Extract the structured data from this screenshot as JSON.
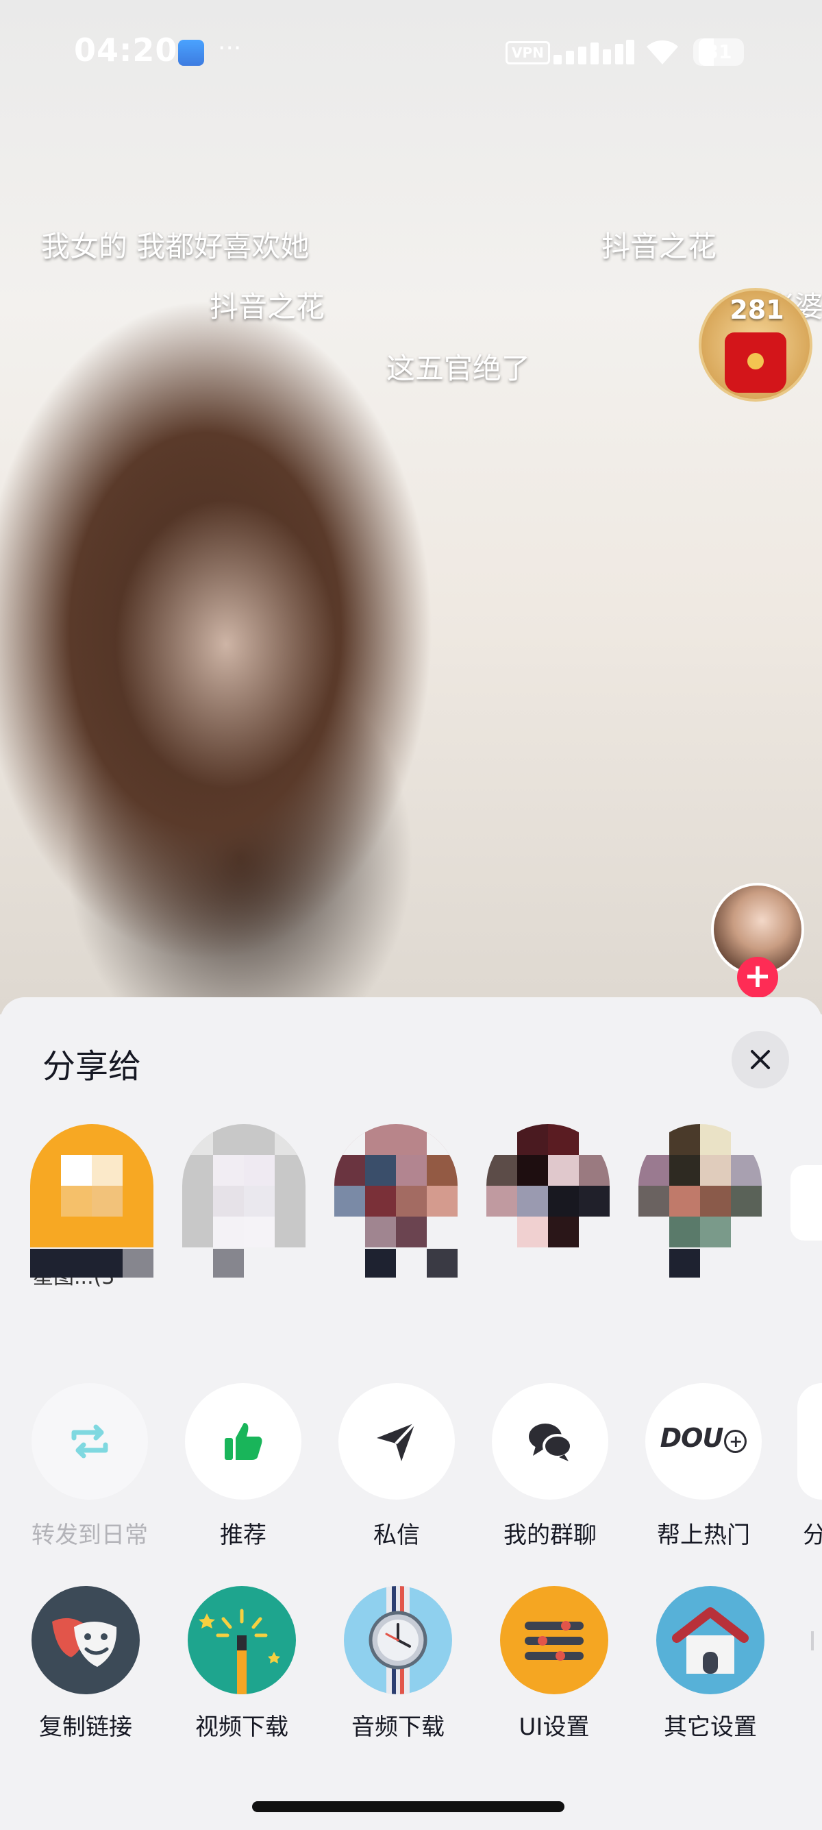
{
  "status_bar": {
    "time": "04:20",
    "dots": "···",
    "vpn": "VPN",
    "battery": "31"
  },
  "danmaku": [
    "我女的 我都好喜欢她",
    "抖音之花",
    "抖音之花",
    "这五官绝了",
    "老婆"
  ],
  "red_packet": {
    "count": "281"
  },
  "share_sheet": {
    "title": "分享给",
    "contacts": [
      {
        "name": "星图...(3"
      },
      {
        "name": ""
      },
      {
        "name": ""
      },
      {
        "name": ""
      },
      {
        "name": ""
      }
    ],
    "actions": [
      {
        "label": "转发到日常",
        "icon": "repost-icon",
        "disabled": true
      },
      {
        "label": "推荐",
        "icon": "thumbs-up-icon"
      },
      {
        "label": "私信",
        "icon": "send-icon"
      },
      {
        "label": "我的群聊",
        "icon": "chat-bubbles-icon"
      },
      {
        "label": "帮上热门",
        "icon": "dou-plus-icon"
      },
      {
        "label": "分",
        "icon": "more-icon"
      }
    ],
    "dou_text": "DOU",
    "tools": [
      {
        "label": "复制链接",
        "icon": "theater-mask-icon",
        "bg": "#3c4a57"
      },
      {
        "label": "视频下载",
        "icon": "magic-wand-icon",
        "bg": "#1ea58e"
      },
      {
        "label": "音频下载",
        "icon": "watch-icon",
        "bg": "#8fd0ee"
      },
      {
        "label": "UI设置",
        "icon": "list-settings-icon",
        "bg": "#f5a622"
      },
      {
        "label": "其它设置",
        "icon": "house-icon",
        "bg": "#57b1d8"
      }
    ]
  },
  "colors": {
    "accent_red": "#fe2c55",
    "thumb_green": "#19b55a",
    "repost_cyan": "#7fd8e0"
  }
}
